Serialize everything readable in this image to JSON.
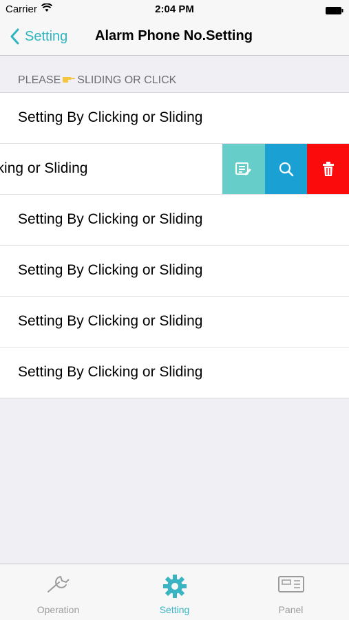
{
  "status_bar": {
    "carrier": "Carrier",
    "time": "2:04 PM"
  },
  "nav": {
    "back_label": "Setting",
    "title": "Alarm Phone No.Setting"
  },
  "section": {
    "header_left": "PLEASE",
    "header_right": "SLIDING OR CLICK",
    "icon": "pointing-hand-icon"
  },
  "rows": [
    {
      "label": "Setting By Clicking or Sliding"
    },
    {
      "label": "Setting By Clicking or Sliding",
      "swiped": true
    },
    {
      "label": "Setting By Clicking or Sliding"
    },
    {
      "label": "Setting By Clicking or Sliding"
    },
    {
      "label": "Setting By Clicking or Sliding"
    },
    {
      "label": "Setting By Clicking or Sliding"
    }
  ],
  "row_actions": [
    {
      "icon": "edit-icon",
      "color": "#67cdc9"
    },
    {
      "icon": "search-icon",
      "color": "#1ba0d3"
    },
    {
      "icon": "trash-icon",
      "color": "#fb0b0b"
    }
  ],
  "tabs": [
    {
      "label": "Operation",
      "icon": "wrench-icon",
      "active": false
    },
    {
      "label": "Setting",
      "icon": "gear-icon",
      "active": true
    },
    {
      "label": "Panel",
      "icon": "panel-icon",
      "active": false
    }
  ],
  "colors": {
    "accent": "#2fb5c0",
    "tab_active": "#3ab3c2",
    "tab_inactive": "#9b9b9b"
  }
}
